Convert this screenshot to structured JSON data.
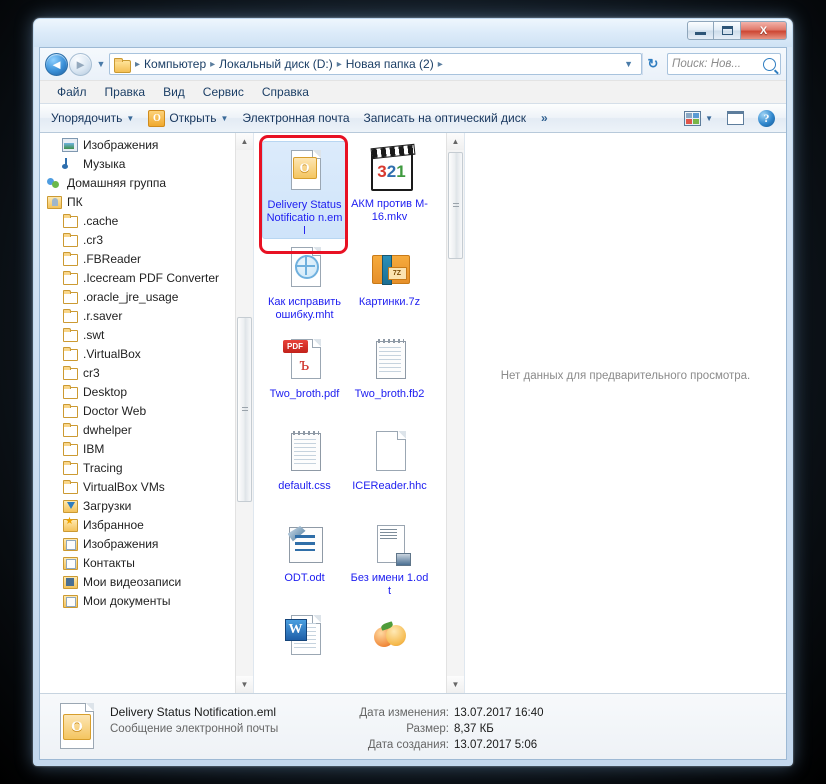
{
  "window": {
    "minimize_label": "Свернуть",
    "maximize_label": "Развернуть",
    "close_label": "X"
  },
  "address": {
    "back_label": "◄",
    "forward_label": "►",
    "recent_label": "▼",
    "folder_icon": "folder-icon",
    "crumbs": [
      "Компьютер",
      "Локальный диск (D:)",
      "Новая папка (2)"
    ],
    "separator": "▸",
    "dropdown_caret": "▼",
    "refresh_label": "↻"
  },
  "search": {
    "placeholder": "Поиск: Нов...",
    "icon": "search-icon"
  },
  "menu": {
    "items": [
      "Файл",
      "Правка",
      "Вид",
      "Сервис",
      "Справка"
    ]
  },
  "toolbar": {
    "organize_label": "Упорядочить",
    "open_label": "Открыть",
    "open_icon_letter": "O",
    "email_label": "Электронная почта",
    "burn_label": "Записать на оптический диск",
    "overflow_label": "»",
    "views_caret": "▼",
    "caret": "▼",
    "help_label": "?"
  },
  "nav_tree": {
    "items": [
      {
        "label": "Изображения",
        "icon": "pics",
        "level": 1
      },
      {
        "label": "Музыка",
        "icon": "music",
        "level": 1
      },
      {
        "label": "Домашняя группа",
        "icon": "home",
        "level": 0
      },
      {
        "label": "ПК",
        "icon": "pc",
        "level": 0
      },
      {
        "label": ".cache",
        "icon": "folder",
        "level": 1
      },
      {
        "label": ".cr3",
        "icon": "folder",
        "level": 1
      },
      {
        "label": ".FBReader",
        "icon": "folder",
        "level": 1
      },
      {
        "label": ".Icecream PDF Converter",
        "icon": "folder",
        "level": 1
      },
      {
        "label": ".oracle_jre_usage",
        "icon": "folder",
        "level": 1
      },
      {
        "label": ".r.saver",
        "icon": "folder",
        "level": 1
      },
      {
        "label": ".swt",
        "icon": "folder",
        "level": 1
      },
      {
        "label": ".VirtualBox",
        "icon": "folder",
        "level": 1
      },
      {
        "label": "cr3",
        "icon": "folder",
        "level": 1
      },
      {
        "label": "Desktop",
        "icon": "folder",
        "level": 1
      },
      {
        "label": "Doctor Web",
        "icon": "folder",
        "level": 1
      },
      {
        "label": "dwhelper",
        "icon": "folder",
        "level": 1
      },
      {
        "label": "IBM",
        "icon": "folder",
        "level": 1
      },
      {
        "label": "Tracing",
        "icon": "folder",
        "level": 1
      },
      {
        "label": "VirtualBox VMs",
        "icon": "folder",
        "level": 1
      },
      {
        "label": "Загрузки",
        "icon": "dl",
        "level": 1
      },
      {
        "label": "Избранное",
        "icon": "fav",
        "level": 1
      },
      {
        "label": "Изображения",
        "icon": "doc",
        "level": 1
      },
      {
        "label": "Контакты",
        "icon": "doc",
        "level": 1
      },
      {
        "label": "Мои видеозаписи",
        "icon": "vid",
        "level": 1
      },
      {
        "label": "Мои документы",
        "icon": "doc",
        "level": 1
      }
    ],
    "scroll_up": "▲",
    "scroll_down": "▼"
  },
  "files": {
    "items": [
      {
        "name": "Delivery Status Notificatio n.eml",
        "glyph": "eml",
        "selected": true
      },
      {
        "name": "АКМ против M-16.mkv",
        "glyph": "mkv",
        "badge": "321",
        "selected": false
      },
      {
        "name": "Как исправить ошибку.mht",
        "glyph": "mht",
        "selected": false
      },
      {
        "name": "Картинки.7z",
        "glyph": "7z",
        "badge": "7Z",
        "selected": false
      },
      {
        "name": "Two_broth.pdf",
        "glyph": "pdf",
        "badge": "PDF",
        "selected": false
      },
      {
        "name": "Two_broth.fb2",
        "glyph": "fb2",
        "selected": false
      },
      {
        "name": "default.css",
        "glyph": "css",
        "selected": false
      },
      {
        "name": "ICEReader.hhc",
        "glyph": "hhc",
        "selected": false
      },
      {
        "name": "ODT.odt",
        "glyph": "odt",
        "selected": false
      },
      {
        "name": "Без имени 1.odt",
        "glyph": "odt2",
        "selected": false
      },
      {
        "name": "",
        "glyph": "doc",
        "badge": "W",
        "selected": false
      },
      {
        "name": "",
        "glyph": "peach",
        "selected": false
      }
    ],
    "scroll_up": "▲",
    "scroll_down": "▼"
  },
  "preview": {
    "empty_message": "Нет данных для предварительного просмотра."
  },
  "details": {
    "file_name": "Delivery Status Notification.eml",
    "file_type": "Сообщение электронной почты",
    "rows": [
      {
        "label": "Дата изменения:",
        "value": "13.07.2017 16:40"
      },
      {
        "label": "Размер:",
        "value": "8,37 КБ"
      },
      {
        "label": "Дата создания:",
        "value": "13.07.2017 5:06"
      }
    ]
  },
  "colors": {
    "accent": "#2f7dc0",
    "annotation": "#e81123",
    "link_text": "#1d1df0",
    "selection": "#cfe4fa"
  }
}
